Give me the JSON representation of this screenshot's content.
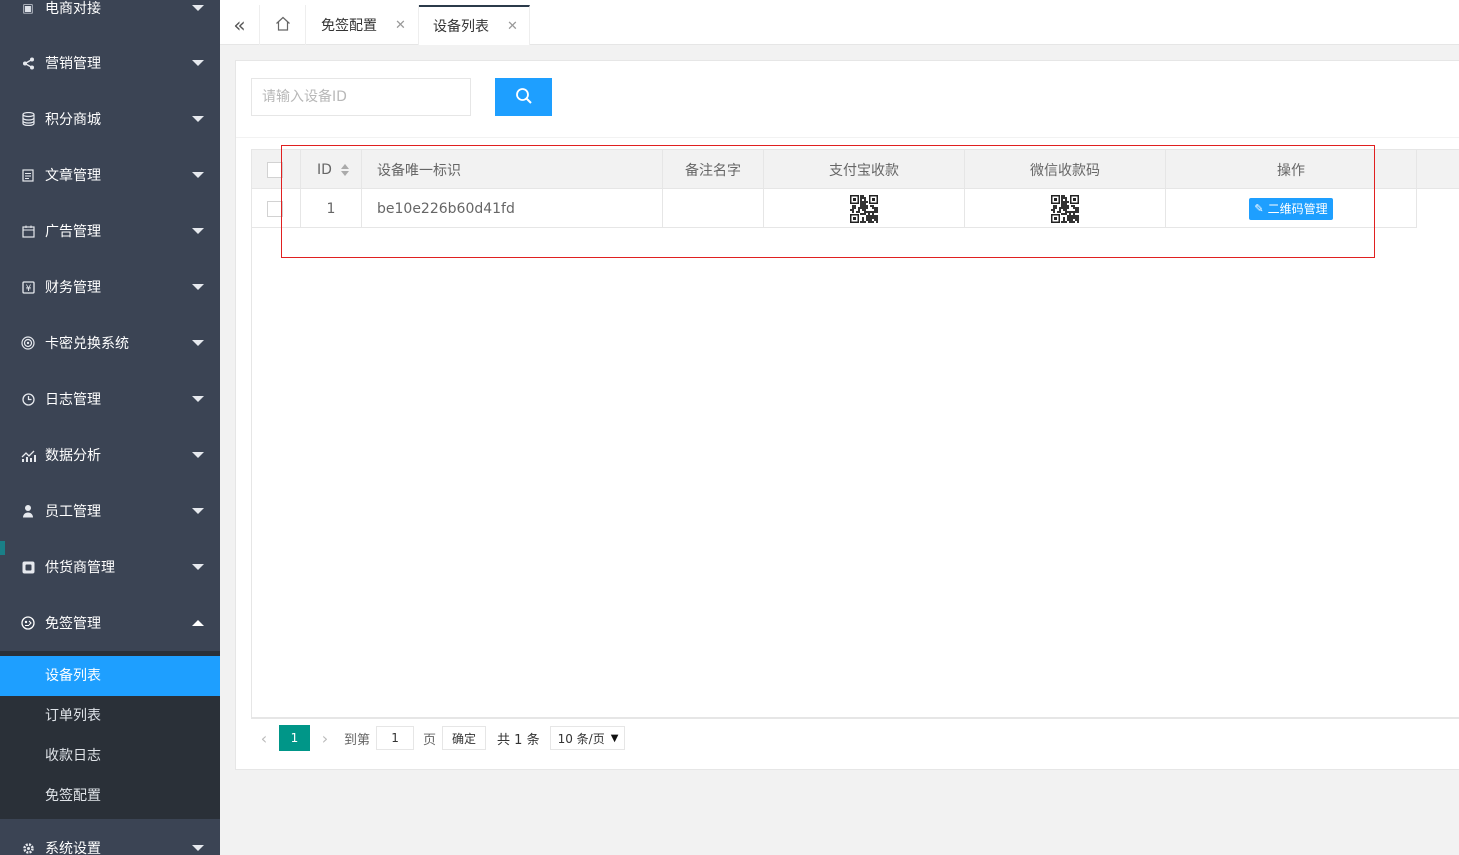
{
  "sidebar": {
    "items": [
      {
        "label": "电商对接",
        "icon": "plug-icon"
      },
      {
        "label": "营销管理",
        "icon": "share-icon"
      },
      {
        "label": "积分商城",
        "icon": "database-icon"
      },
      {
        "label": "文章管理",
        "icon": "document-icon"
      },
      {
        "label": "广告管理",
        "icon": "calendar-icon"
      },
      {
        "label": "财务管理",
        "icon": "finance-icon"
      },
      {
        "label": "卡密兑换系统",
        "icon": "target-icon"
      },
      {
        "label": "日志管理",
        "icon": "clock-icon"
      },
      {
        "label": "数据分析",
        "icon": "chart-icon"
      },
      {
        "label": "员工管理",
        "icon": "user-icon"
      },
      {
        "label": "供货商管理",
        "icon": "store-icon"
      },
      {
        "label": "免签管理",
        "icon": "badge-icon"
      },
      {
        "label": "系统设置",
        "icon": "gear-icon"
      }
    ],
    "submenu": [
      {
        "label": "设备列表",
        "active": true
      },
      {
        "label": "订单列表",
        "active": false
      },
      {
        "label": "收款日志",
        "active": false
      },
      {
        "label": "免签配置",
        "active": false
      }
    ]
  },
  "tabs": [
    {
      "label": "免签配置",
      "active": false
    },
    {
      "label": "设备列表",
      "active": true
    }
  ],
  "search": {
    "placeholder": "请输入设备ID",
    "value": ""
  },
  "table": {
    "columns": [
      "ID",
      "设备唯一标识",
      "备注名字",
      "支付宝收款",
      "微信收款码",
      "操作"
    ],
    "rows": [
      {
        "id": "1",
        "device_uid": "be10e226b60d41fd",
        "remark": "",
        "alipay_qr": "qr-code-icon",
        "wechat_qr": "qr-code-icon",
        "action_label": "二维码管理"
      }
    ]
  },
  "pagination": {
    "current_page": "1",
    "goto_label": "到第",
    "goto_value": "1",
    "page_label": "页",
    "confirm_label": "确定",
    "total_label": "共 1 条",
    "page_size_label": "10 条/页"
  },
  "colors": {
    "sidebar_bg": "#3b4454",
    "submenu_bg": "#2a3038",
    "accent": "#1e9fff",
    "pager_active": "#009688",
    "annotation": "#e02020"
  }
}
